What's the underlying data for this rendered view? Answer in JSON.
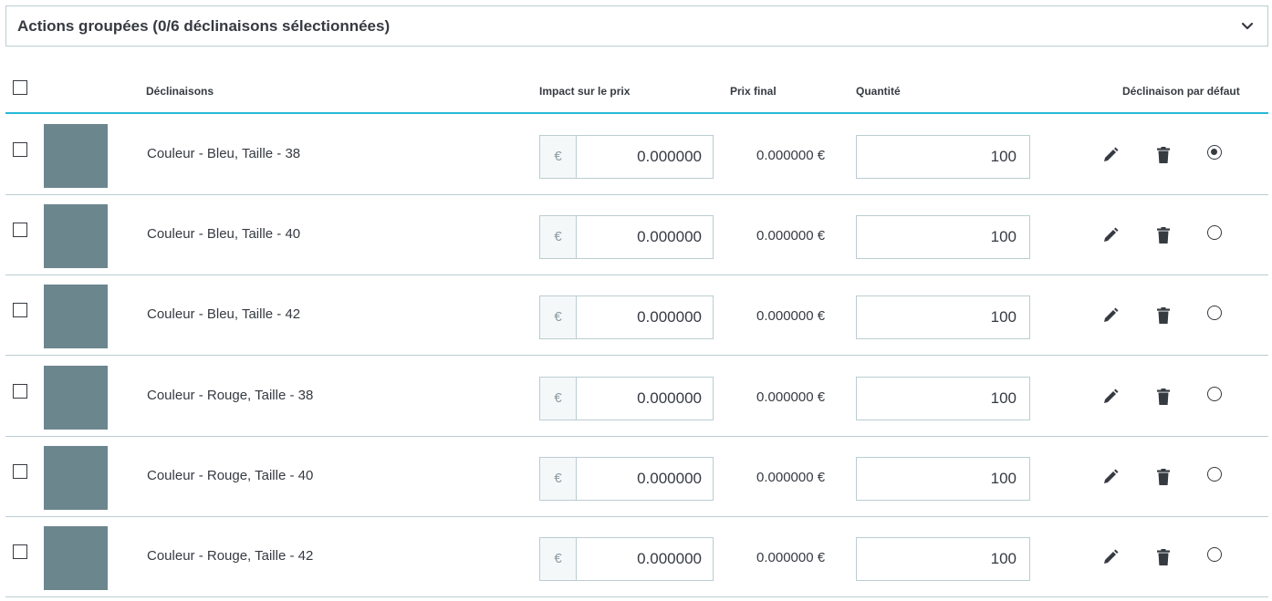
{
  "bulk_actions": {
    "title": "Actions groupées (0/6 déclinaisons sélectionnées)",
    "chevron_icon": "chevron-down-icon"
  },
  "table": {
    "headers": {
      "combinations": "Déclinaisons",
      "price_impact": "Impact sur le prix",
      "final_price": "Prix final",
      "quantity": "Quantité",
      "default": "Déclinaison par défaut"
    },
    "currency_symbol": "€",
    "rows": [
      {
        "name": "Couleur - Bleu, Taille - 38",
        "price_impact": "0.000000",
        "final_price": "0.000000 €",
        "quantity": "100",
        "checked": false,
        "is_default": true
      },
      {
        "name": "Couleur - Bleu, Taille - 40",
        "price_impact": "0.000000",
        "final_price": "0.000000 €",
        "quantity": "100",
        "checked": false,
        "is_default": false
      },
      {
        "name": "Couleur - Bleu, Taille - 42",
        "price_impact": "0.000000",
        "final_price": "0.000000 €",
        "quantity": "100",
        "checked": false,
        "is_default": false
      },
      {
        "name": "Couleur - Rouge, Taille - 38",
        "price_impact": "0.000000",
        "final_price": "0.000000 €",
        "quantity": "100",
        "checked": false,
        "is_default": false
      },
      {
        "name": "Couleur - Rouge, Taille - 40",
        "price_impact": "0.000000",
        "final_price": "0.000000 €",
        "quantity": "100",
        "checked": false,
        "is_default": false
      },
      {
        "name": "Couleur - Rouge, Taille - 42",
        "price_impact": "0.000000",
        "final_price": "0.000000 €",
        "quantity": "100",
        "checked": false,
        "is_default": false
      }
    ]
  },
  "colors": {
    "thumbnail": "#6c868e",
    "border": "#bbcdd2",
    "header_accent": "#25b9d7",
    "text": "#363a41"
  }
}
